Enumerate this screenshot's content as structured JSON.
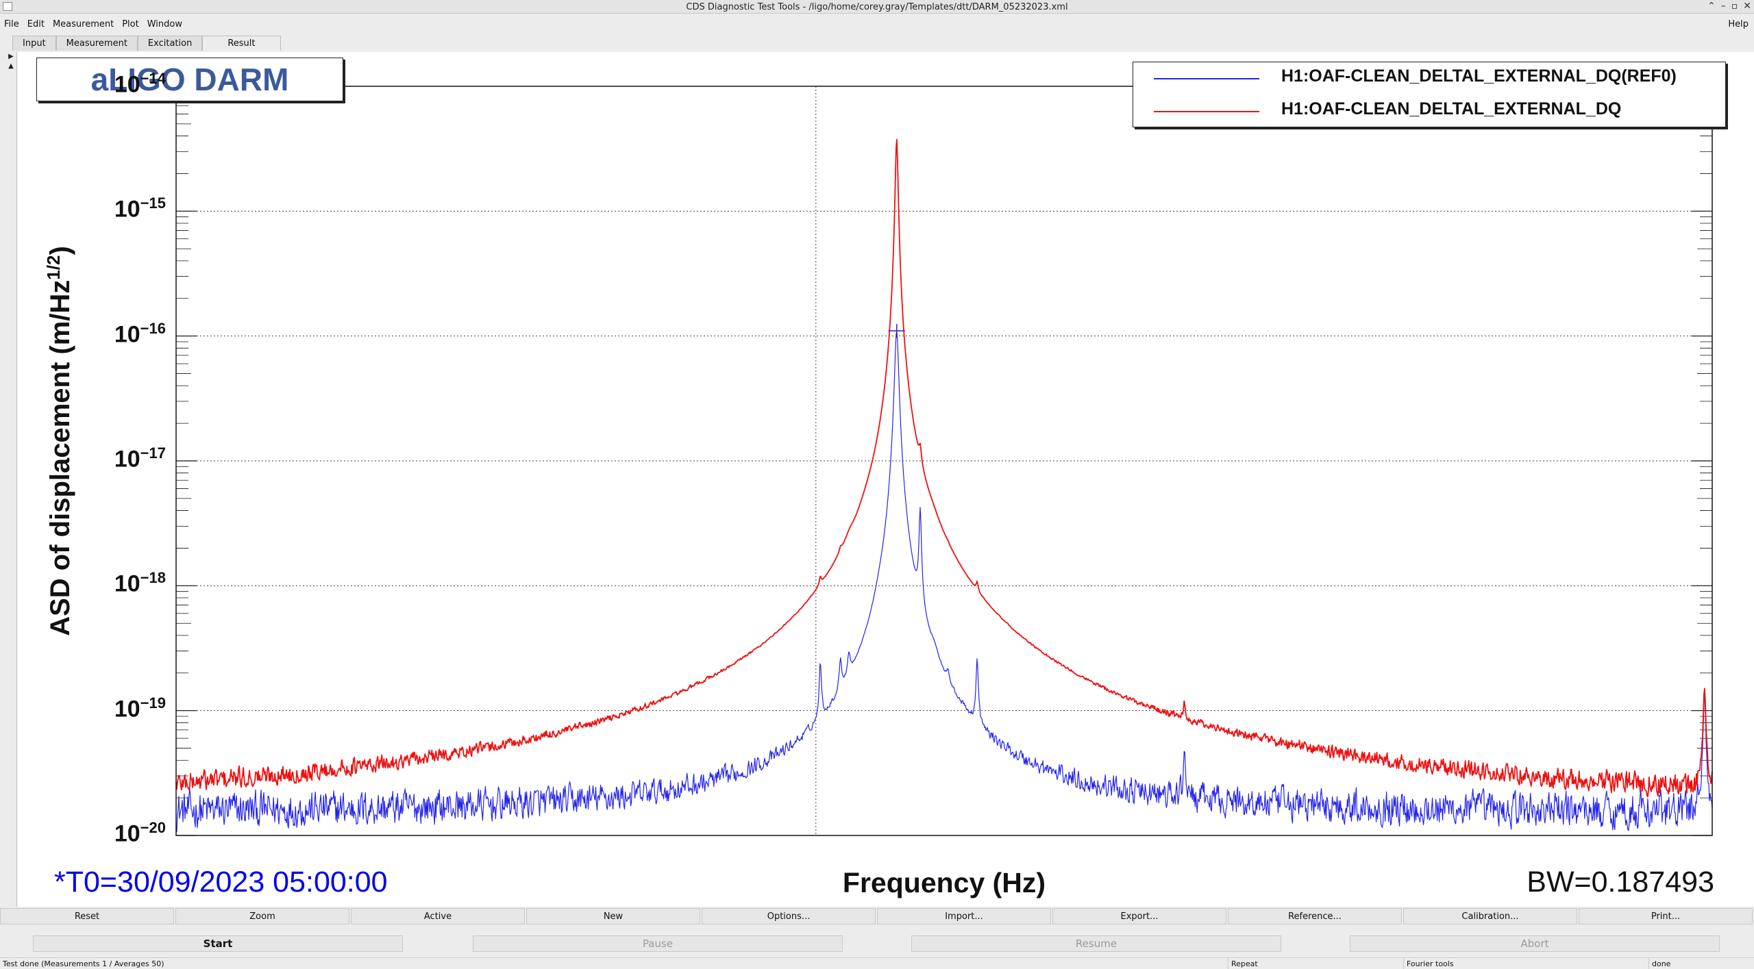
{
  "window": {
    "title": "CDS Diagnostic Test Tools - /ligo/home/corey.gray/Templates/dtt/DARM_05232023.xml"
  },
  "menu": {
    "items": [
      "File",
      "Edit",
      "Measurement",
      "Plot",
      "Window"
    ],
    "help": "Help"
  },
  "tabs": [
    "Input",
    "Measurement",
    "Excitation",
    "Result"
  ],
  "plot": {
    "title": "aLIGO DARM",
    "legend": [
      {
        "label": "H1:OAF-CLEAN_DELTAL_EXTERNAL_DQ(REF0)",
        "color": "#2222ee"
      },
      {
        "label": "H1:OAF-CLEAN_DELTAL_EXTERNAL_DQ",
        "color": "#ee1111"
      }
    ],
    "ylabel_main": "ASD of displacement (m/Hz",
    "ylabel_sup": "1/2",
    "ylabel_close": ")",
    "xlabel": "Frequency (Hz)",
    "t0": "*T0=30/09/2023 05:00:00",
    "bw": "BW=0.187493",
    "ytick_base": "10",
    "ytick_exponents": [
      "−14",
      "−15",
      "−16",
      "−17",
      "−18",
      "−19",
      "−20"
    ]
  },
  "chart_data": {
    "type": "line",
    "title": "aLIGO DARM",
    "xlabel": "Frequency (Hz)",
    "ylabel": "ASD of displacement (m/Hz^1/2)",
    "y_scale": "log",
    "ylim": [
      1e-20,
      1e-14
    ],
    "y_ticks": [
      "10^-14",
      "10^-15",
      "10^-16",
      "10^-17",
      "10^-18",
      "10^-19",
      "10^-20"
    ],
    "grid": true,
    "legend_position": "top-right",
    "x_relative_range": [
      0,
      1
    ],
    "noise_floor": 1.5e-20,
    "series": [
      {
        "name": "H1:OAF-CLEAN_DELTAL_EXTERNAL_DQ(REF0)",
        "color": "#2222ee",
        "peaks": [
          {
            "x": 0.4194,
            "value": 1.6e-19,
            "width": 0.0007
          },
          {
            "x": 0.4325,
            "value": 1.2e-19,
            "width": 0.0008
          },
          {
            "x": 0.438,
            "value": 1e-19,
            "width": 0.001
          },
          {
            "x": 0.4585,
            "value": 5e-20,
            "width": 0.003
          },
          {
            "x": 0.4691,
            "value": 1.1e-16,
            "width": 0.0012
          },
          {
            "x": 0.4691,
            "value": 8e-19,
            "width": 0.0045
          },
          {
            "x": 0.4844,
            "value": 3.5e-18,
            "width": 0.0007
          },
          {
            "x": 0.4935,
            "value": 4e-20,
            "width": 0.0025
          },
          {
            "x": 0.5025,
            "value": 4e-20,
            "width": 0.0008
          },
          {
            "x": 0.5215,
            "value": 1.8e-19,
            "width": 0.0007
          },
          {
            "x": 0.6565,
            "value": 3e-20,
            "width": 0.0007
          },
          {
            "x": 0.995,
            "value": 1.2e-19,
            "width": 0.0008
          }
        ]
      },
      {
        "name": "H1:OAF-CLEAN_DELTAL_EXTERNAL_DQ",
        "color": "#ee1111",
        "peaks": [
          {
            "x": 0.4194,
            "value": 1.7e-19,
            "width": 0.0007
          },
          {
            "x": 0.4325,
            "value": 1.6e-19,
            "width": 0.0009
          },
          {
            "x": 0.4385,
            "value": 2e-19,
            "width": 0.003
          },
          {
            "x": 0.45,
            "value": 2e-19,
            "width": 0.0055
          },
          {
            "x": 0.4691,
            "value": 3.8e-15,
            "width": 0.0008
          },
          {
            "x": 0.4691,
            "value": 1.4e-18,
            "width": 0.006
          },
          {
            "x": 0.4844,
            "value": 3.2e-18,
            "width": 0.0008
          },
          {
            "x": 0.493,
            "value": 1.5e-19,
            "width": 0.004
          },
          {
            "x": 0.5025,
            "value": 4e-20,
            "width": 0.0008
          },
          {
            "x": 0.5215,
            "value": 1.6e-19,
            "width": 0.0007
          },
          {
            "x": 0.6565,
            "value": 3e-20,
            "width": 0.0007
          },
          {
            "x": 0.995,
            "value": 1.3e-19,
            "width": 0.0008
          }
        ]
      }
    ]
  },
  "toolbar": [
    "Reset",
    "Zoom",
    "Active",
    "New",
    "Options...",
    "Import...",
    "Export...",
    "Reference...",
    "Calibration...",
    "Print..."
  ],
  "controls": [
    {
      "label": "Start",
      "enabled": true
    },
    {
      "label": "Pause",
      "enabled": false
    },
    {
      "label": "Resume",
      "enabled": false
    },
    {
      "label": "Abort",
      "enabled": false
    }
  ],
  "status": {
    "message": "Test done (Measurements 1 / Averages 50)",
    "repeat": "Repeat",
    "tool": "Fourier tools",
    "state": "done"
  }
}
